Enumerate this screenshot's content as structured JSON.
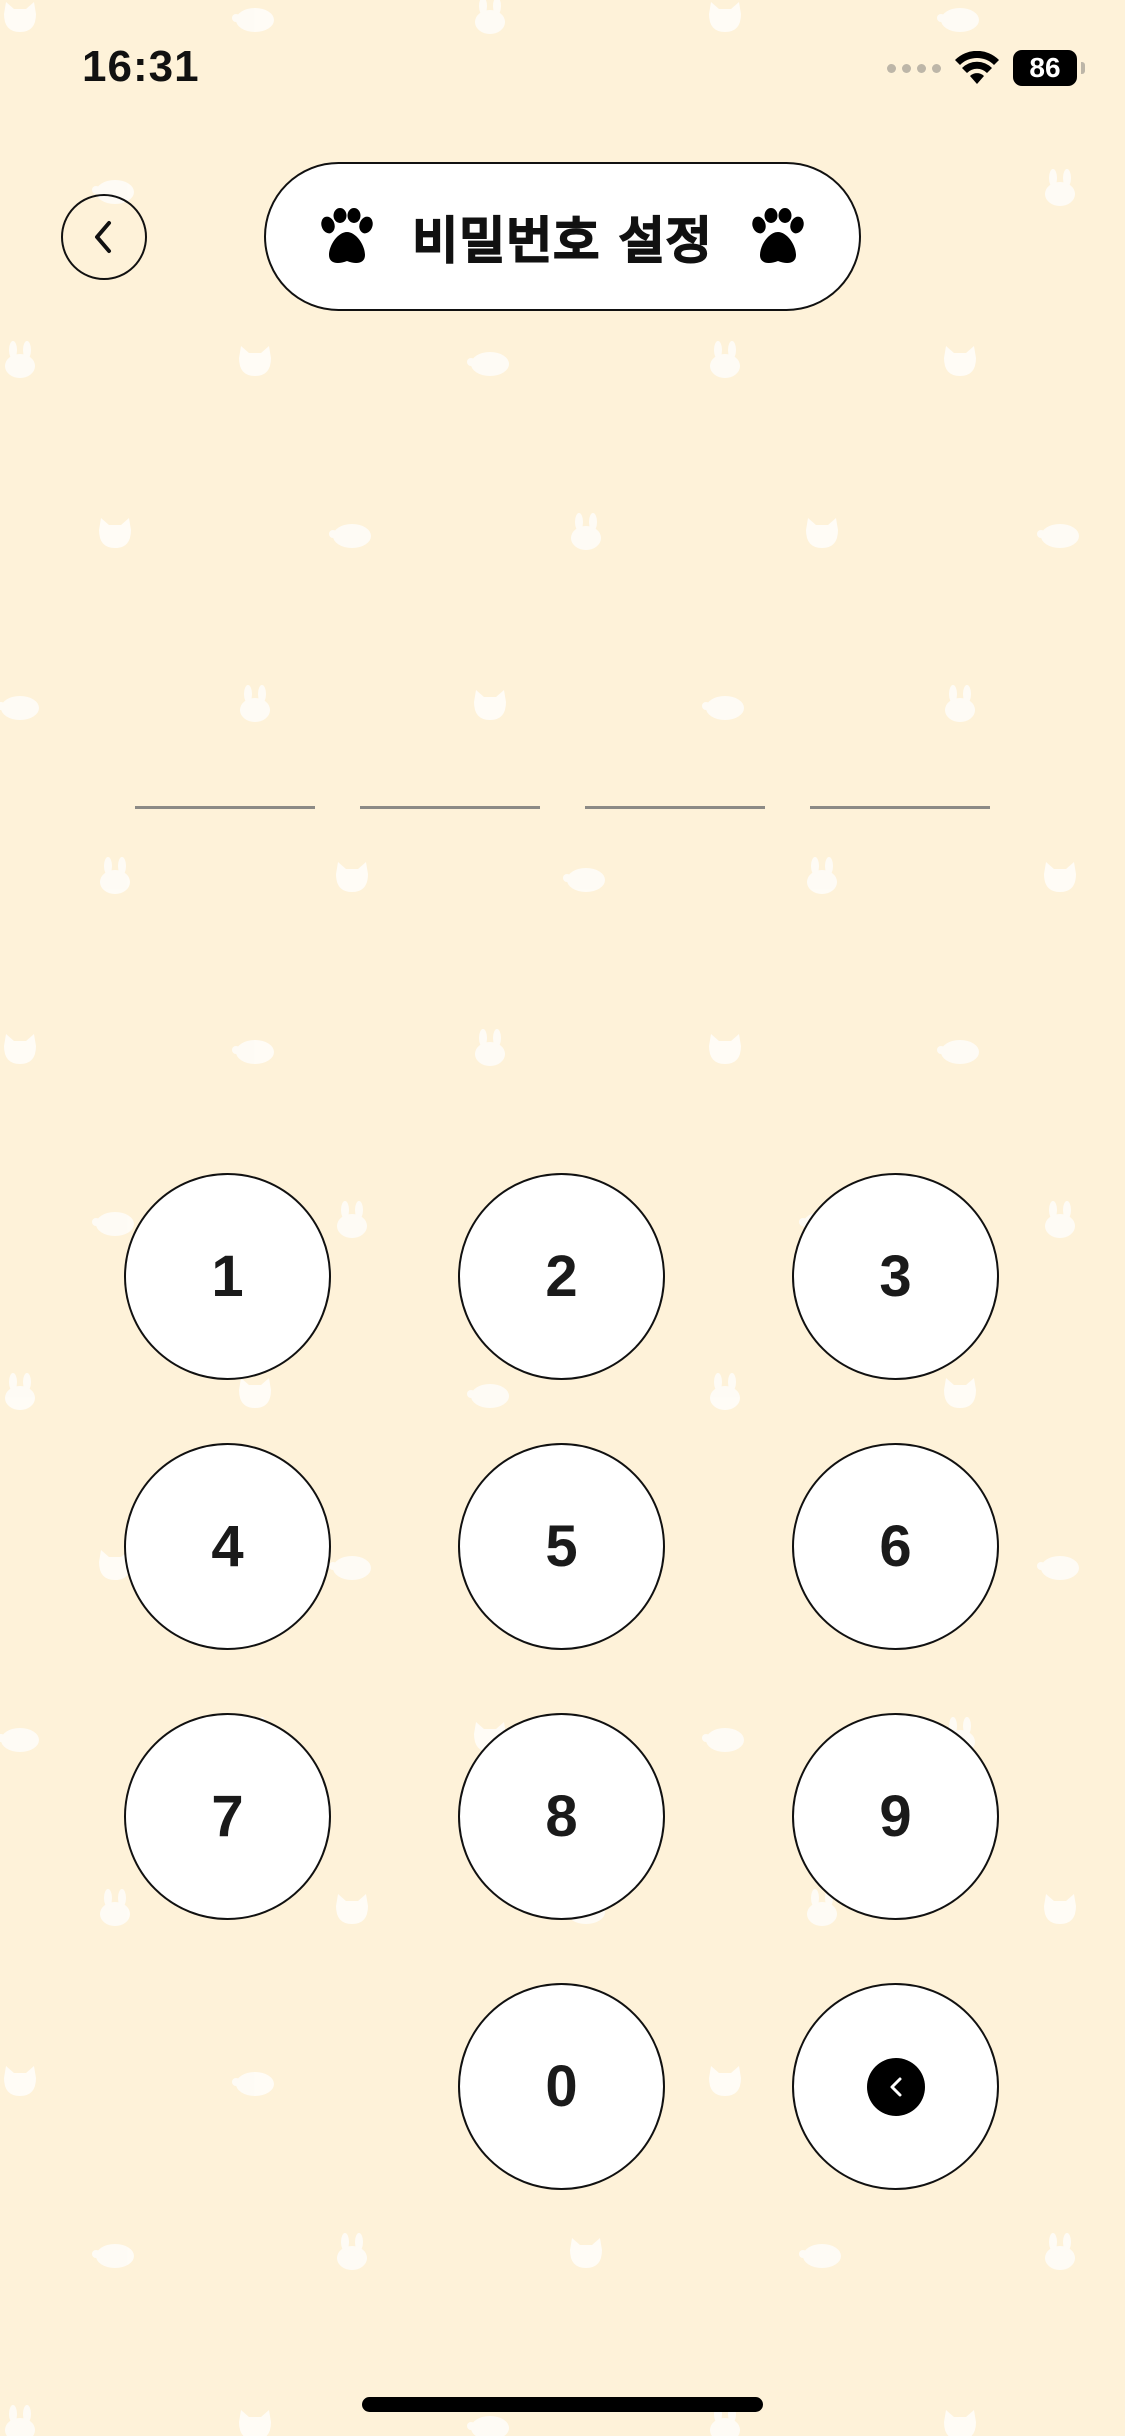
{
  "status_bar": {
    "time": "16:31",
    "battery": "86"
  },
  "header": {
    "title": "비밀번호 설정",
    "back_icon": "chevron-left-icon",
    "title_icons": [
      "paw-icon",
      "paw-icon"
    ]
  },
  "pin": {
    "length": 4,
    "entered": 0
  },
  "keypad": {
    "keys": [
      "1",
      "2",
      "3",
      "4",
      "5",
      "6",
      "7",
      "8",
      "9",
      "0"
    ],
    "delete_icon": "backspace-icon"
  },
  "colors": {
    "background": "#FEF2D9",
    "pattern": "#FFFFFF",
    "key_fill": "#FFFFFF",
    "outline": "#111111",
    "slot_line": "#8C8A86"
  }
}
